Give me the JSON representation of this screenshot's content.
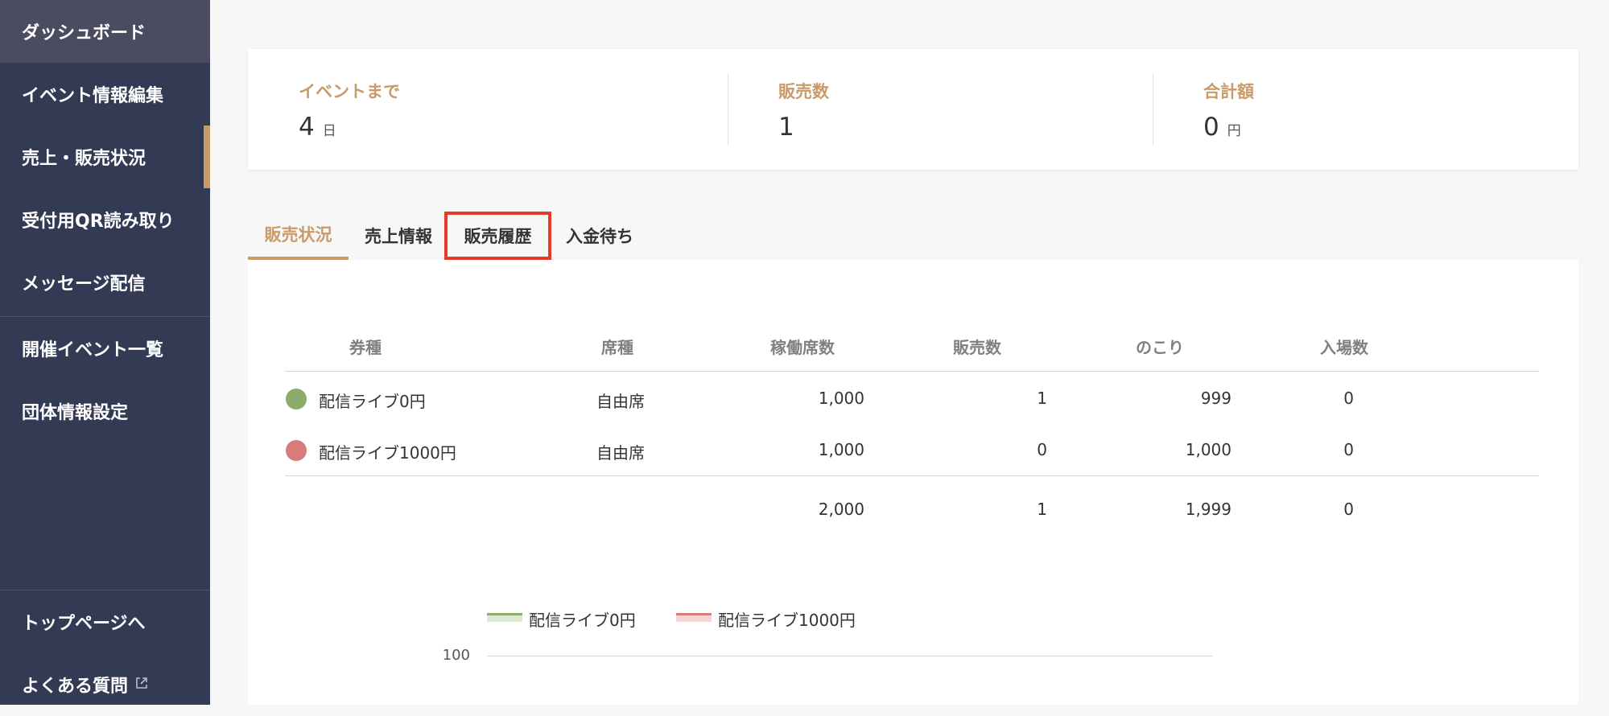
{
  "sidebar": {
    "items": [
      {
        "label": "ダッシュボード"
      },
      {
        "label": "イベント情報編集"
      },
      {
        "label": "売上・販売状況"
      },
      {
        "label": "受付用QR読み取り"
      },
      {
        "label": "メッセージ配信"
      },
      {
        "label": "開催イベント一覧"
      },
      {
        "label": "団体情報設定"
      }
    ],
    "footer": [
      {
        "label": "トップページへ"
      },
      {
        "label": "よくある質問",
        "icon": "external-link-icon"
      }
    ]
  },
  "stats": {
    "days": {
      "label": "イベントまで",
      "value": "4",
      "unit": "日"
    },
    "sold": {
      "label": "販売数",
      "value": "1"
    },
    "total": {
      "label": "合計額",
      "value": "0",
      "unit": "円"
    }
  },
  "tabs": [
    {
      "label": "販売状況",
      "active": true
    },
    {
      "label": "売上情報"
    },
    {
      "label": "販売履歴",
      "highlighted": true
    },
    {
      "label": "入金待ち"
    }
  ],
  "table": {
    "headers": [
      "券種",
      "席種",
      "稼働席数",
      "販売数",
      "のこり",
      "入場数"
    ],
    "rows": [
      {
        "name": "配信ライブ0円",
        "seat": "自由席",
        "capacity": "1,000",
        "sold": "1",
        "remaining": "999",
        "entered": "0",
        "color": "#8aad6e"
      },
      {
        "name": "配信ライブ1000円",
        "seat": "自由席",
        "capacity": "1,000",
        "sold": "0",
        "remaining": "1,000",
        "entered": "0",
        "color": "#d97b7b"
      }
    ],
    "totals": {
      "capacity": "2,000",
      "sold": "1",
      "remaining": "1,999",
      "entered": "0"
    }
  },
  "chart_data": {
    "type": "line",
    "series": [
      {
        "name": "配信ライブ0円",
        "color": "#8aad6e"
      },
      {
        "name": "配信ライブ1000円",
        "color": "#d97b7b"
      }
    ],
    "y_ticks": [
      "100"
    ],
    "legend_position": "top"
  }
}
